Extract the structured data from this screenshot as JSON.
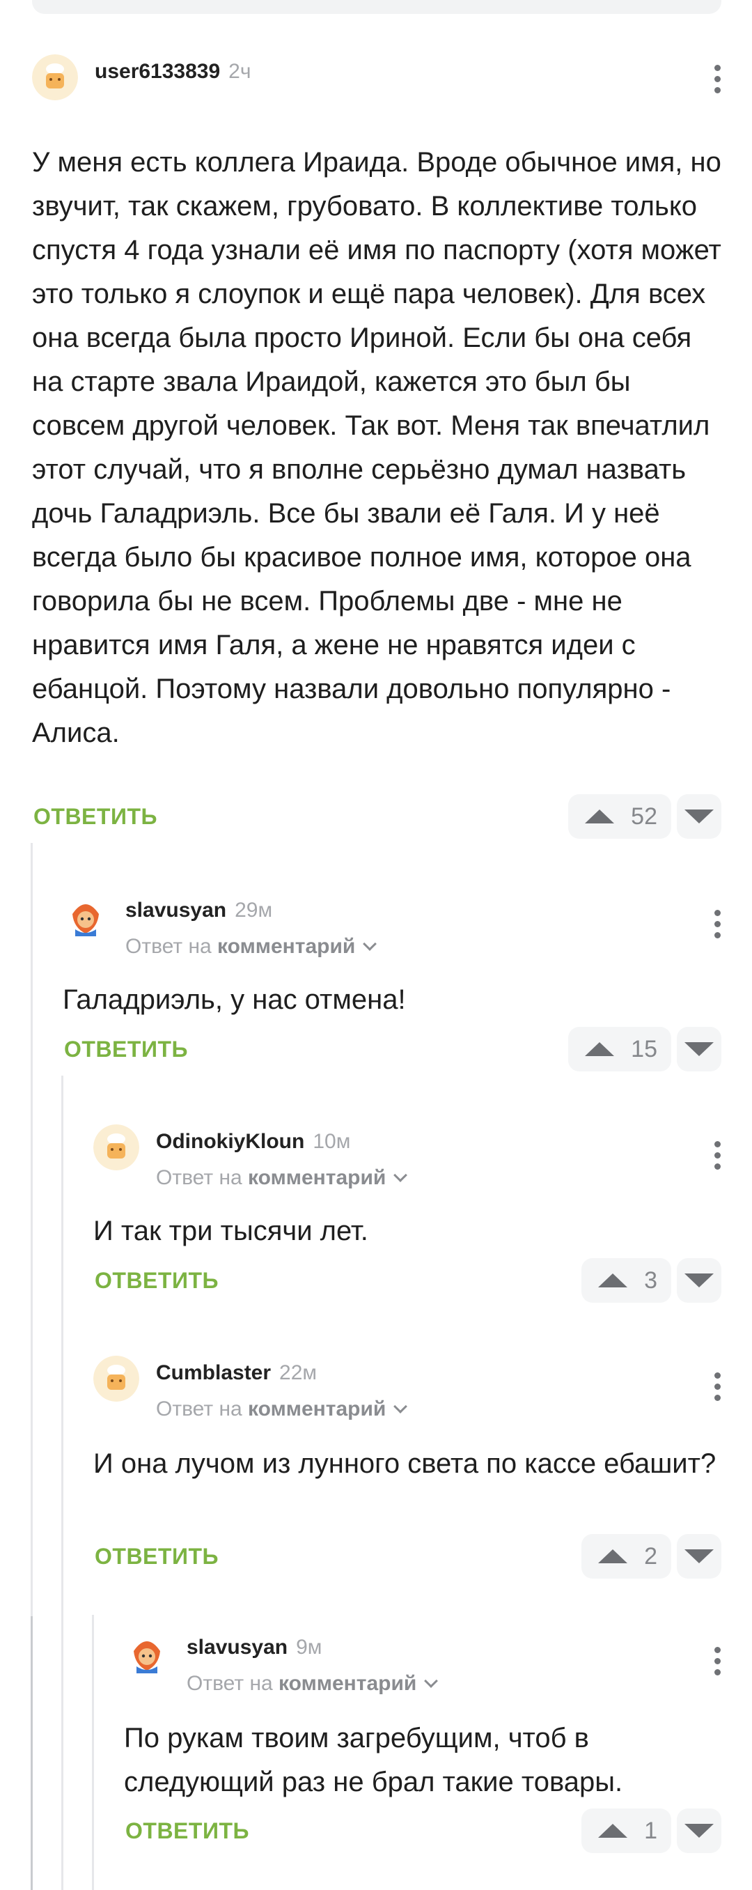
{
  "reply_label": "ОТВЕТИТЬ",
  "reply_to_prefix": "Ответ на",
  "reply_to_link": "комментарий",
  "comments": [
    {
      "username": "user6133839",
      "time": "2ч",
      "text": "У меня есть коллега Ираида. Вроде обычное имя, но звучит, так скажем, грубовато. В коллективе только спустя 4 года узнали её имя по паспорту (хотя может это только я слоупок и ещё пара человек). Для всех она всегда была просто Ириной. Если бы она себя на старте звала Ираидой, кажется это был бы совсем другой человек. Так вот. Меня так впечатлил этот случай, что я вполне серьёзно думал назвать дочь Галадриэль. Все бы звали её Галя. И у неё всегда было бы красивое полное имя, которое она говорила бы не всем. Проблемы две - мне не нравится имя Галя, а жене не нравятся идеи с ебанцой. Поэтому назвали довольно популярно - Алиса.",
      "rating": "52"
    },
    {
      "username": "slavusyan",
      "time": "29м",
      "text": "Галадриэль, у нас отмена!",
      "rating": "15"
    },
    {
      "username": "OdinokiyKloun",
      "time": "10м",
      "text": "И так три тысячи лет.",
      "rating": "3"
    },
    {
      "username": "Cumblaster",
      "time": "22м",
      "text": "И она лучом из лунного света по кассе ебашит?",
      "rating": "2"
    },
    {
      "username": "slavusyan",
      "time": "9м",
      "text": "По рукам твоим загребущим, чтоб в следующий раз не брал такие товары.",
      "rating": "1"
    }
  ],
  "icons": {
    "more": "kebab-menu-icon",
    "upvote": "arrow-up-icon",
    "downvote": "arrow-down-icon",
    "expand": "chevron-down-icon"
  },
  "colors": {
    "reply_green": "#7cb342",
    "muted_gray": "#a5a7ab",
    "vote_bg": "#f4f5f6"
  }
}
